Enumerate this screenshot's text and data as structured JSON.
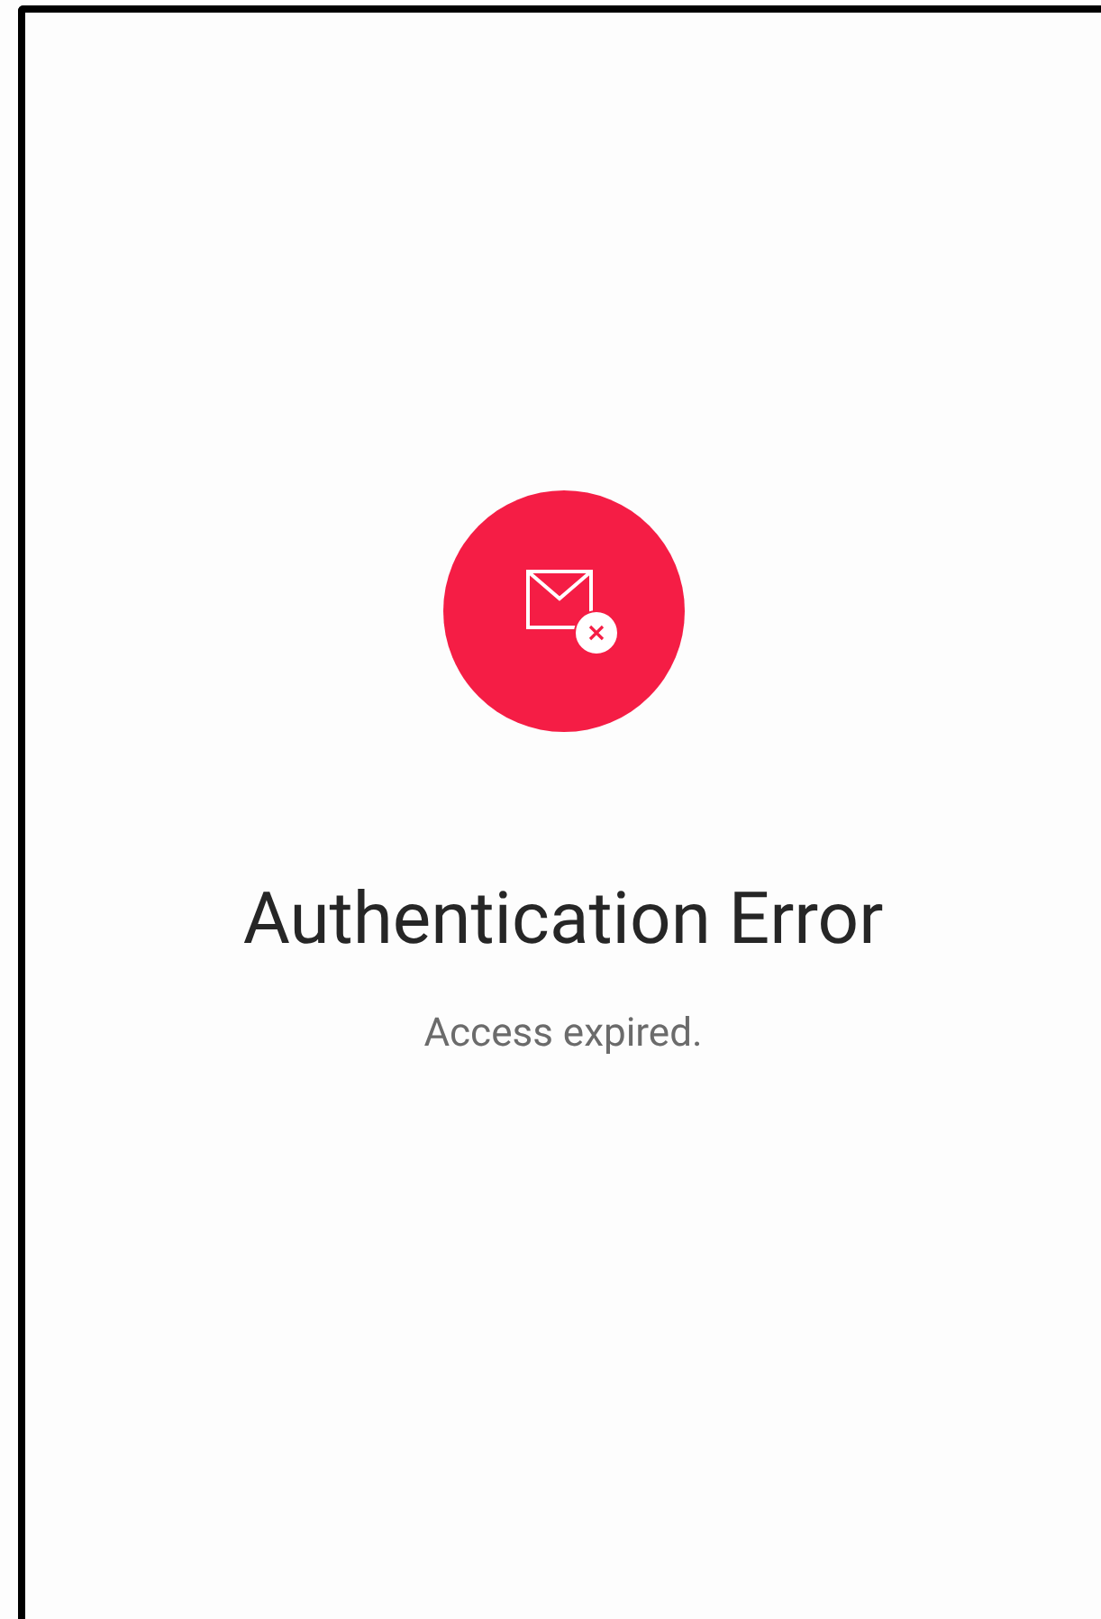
{
  "status": {
    "kind": "error",
    "title": "Authentication Error",
    "message": "Access expired."
  }
}
